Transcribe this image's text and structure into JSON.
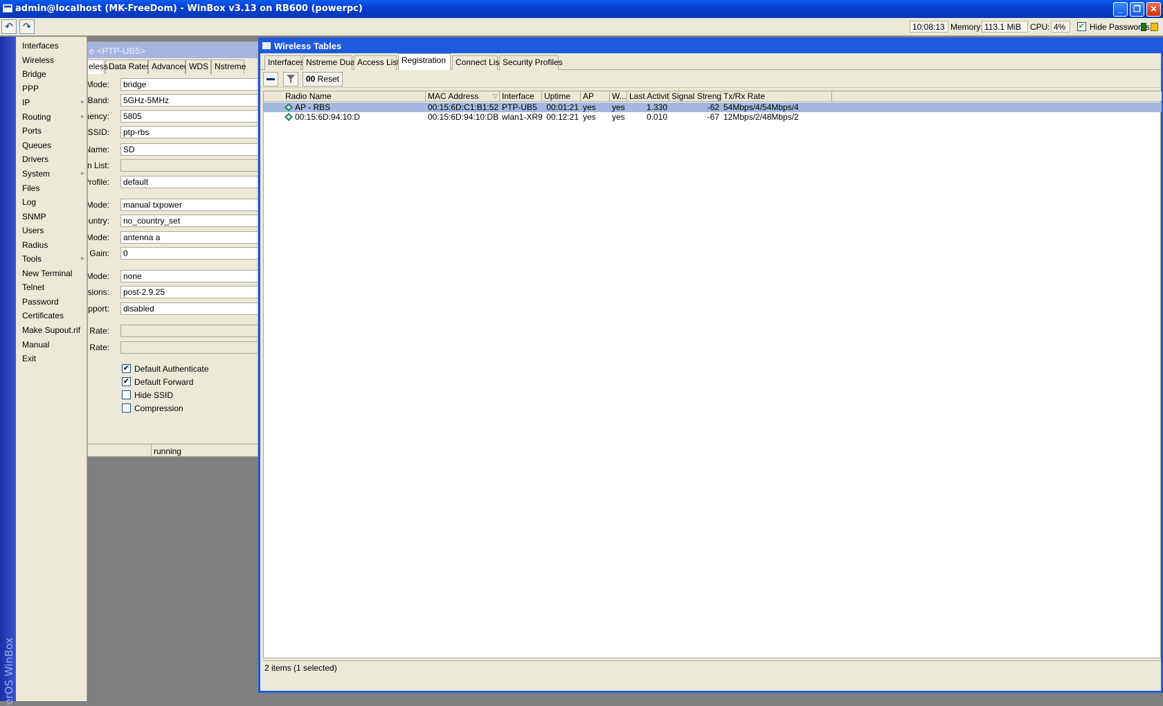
{
  "window": {
    "title": "admin@localhost (MK-FreeDom) - WinBox v3.13 on RB600 (powerpc)",
    "minimize_glyph": "_",
    "maximize_glyph": "❐",
    "close_glyph": "✕"
  },
  "toolbar": {
    "undo_icon": "↶",
    "redo_icon": "↷",
    "time": "10:08:13",
    "memory_label": "Memory:",
    "memory_value": "113.1 MiB",
    "cpu_label": "CPU:",
    "cpu_value": "4%",
    "hide_passwords_label": "Hide Passwords",
    "hide_passwords_checked": true
  },
  "sidebar": {
    "brand": "RouterOS WinBox",
    "items": [
      {
        "label": "Interfaces",
        "submenu": false
      },
      {
        "label": "Wireless",
        "submenu": false
      },
      {
        "label": "Bridge",
        "submenu": false
      },
      {
        "label": "PPP",
        "submenu": false
      },
      {
        "label": "IP",
        "submenu": true
      },
      {
        "label": "Routing",
        "submenu": true
      },
      {
        "label": "Ports",
        "submenu": false
      },
      {
        "label": "Queues",
        "submenu": false
      },
      {
        "label": "Drivers",
        "submenu": false
      },
      {
        "label": "System",
        "submenu": true
      },
      {
        "label": "Files",
        "submenu": false
      },
      {
        "label": "Log",
        "submenu": false
      },
      {
        "label": "SNMP",
        "submenu": false
      },
      {
        "label": "Users",
        "submenu": false
      },
      {
        "label": "Radius",
        "submenu": false
      },
      {
        "label": "Tools",
        "submenu": true
      },
      {
        "label": "New Terminal",
        "submenu": false
      },
      {
        "label": "Telnet",
        "submenu": false
      },
      {
        "label": "Password",
        "submenu": false
      },
      {
        "label": "Certificates",
        "submenu": false
      },
      {
        "label": "Make Supout.rif",
        "submenu": false
      },
      {
        "label": "Manual",
        "submenu": false
      },
      {
        "label": "Exit",
        "submenu": false
      }
    ]
  },
  "interface_window": {
    "title": "e <PTP-UB5>",
    "tabs": [
      "eless",
      "Data Rates",
      "Advanced",
      "WDS",
      "Nstreme"
    ],
    "fields": [
      {
        "label": "Mode:",
        "value": "bridge"
      },
      {
        "label": "Band:",
        "value": "5GHz-5MHz"
      },
      {
        "label": "equency:",
        "value": "5805"
      },
      {
        "label": "SSID:",
        "value": "ptp-rbs"
      },
      {
        "label": "io Name:",
        "value": "SD"
      },
      {
        "label": "Scan List:",
        "value": ""
      },
      {
        "label": "ty Profile:",
        "value": "default"
      },
      {
        "label": "cy Mode:",
        "value": "manual txpower"
      },
      {
        "label": "Country:",
        "value": "no_country_set"
      },
      {
        "label": "na Mode:",
        "value": "antenna a"
      },
      {
        "label": "nna Gain:",
        "value": "0"
      },
      {
        "label": "TS Mode:",
        "value": "none"
      },
      {
        "label": "xtensions:",
        "value": "post-2.9.25"
      },
      {
        "label": "Support:",
        "value": "disabled"
      },
      {
        "label": "Tx Rate:",
        "value": ""
      },
      {
        "label": "Tx Rate:",
        "value": ""
      }
    ],
    "checkboxes": [
      {
        "label": "Default Authenticate",
        "checked": true
      },
      {
        "label": "Default Forward",
        "checked": true
      },
      {
        "label": "Hide SSID",
        "checked": false
      },
      {
        "label": "Compression",
        "checked": false
      }
    ],
    "status": "running"
  },
  "wireless_tables": {
    "title": "Wireless Tables",
    "tabs": [
      "Interfaces",
      "Nstreme Dual",
      "Access List",
      "Registration",
      "Connect List",
      "Security Profiles"
    ],
    "active_tab": "Registration",
    "remove_icon": "minus-icon",
    "filter_icon": "filter-icon",
    "reset_prefix": "00",
    "reset_label": "Reset",
    "columns": [
      "Radio Name",
      "MAC Address",
      "Interface",
      "Uptime",
      "AP",
      "W...",
      "Last Activit...",
      "Signal Strengt...",
      "Tx/Rx Rate"
    ],
    "sort_indicator": "▽",
    "rows": [
      {
        "radio_name": "AP - RBS",
        "mac": "00:15:6D:C1:B1:52",
        "interface": "PTP-UB5",
        "uptime": "00:01:21",
        "ap": "yes",
        "w": "yes",
        "last_activity": "1.330",
        "signal": "-62",
        "rate": "54Mbps/4/54Mbps/4",
        "selected": true
      },
      {
        "radio_name": "00:15:6D:94:10:D",
        "mac": "00:15:6D:94:10:DB",
        "interface": "wlan1-XR9",
        "uptime": "00:12:21",
        "ap": "yes",
        "w": "yes",
        "last_activity": "0.010",
        "signal": "-67",
        "rate": "12Mbps/2/48Mbps/2",
        "selected": false
      }
    ],
    "status": "2 items (1 selected)"
  },
  "colors": {
    "title_blue": "#0a3fd0",
    "window_border": "#1e5bdb",
    "panel": "#ece9d8",
    "selection": "#a3b8de",
    "sidebar_blue": "#1b2fa8"
  }
}
